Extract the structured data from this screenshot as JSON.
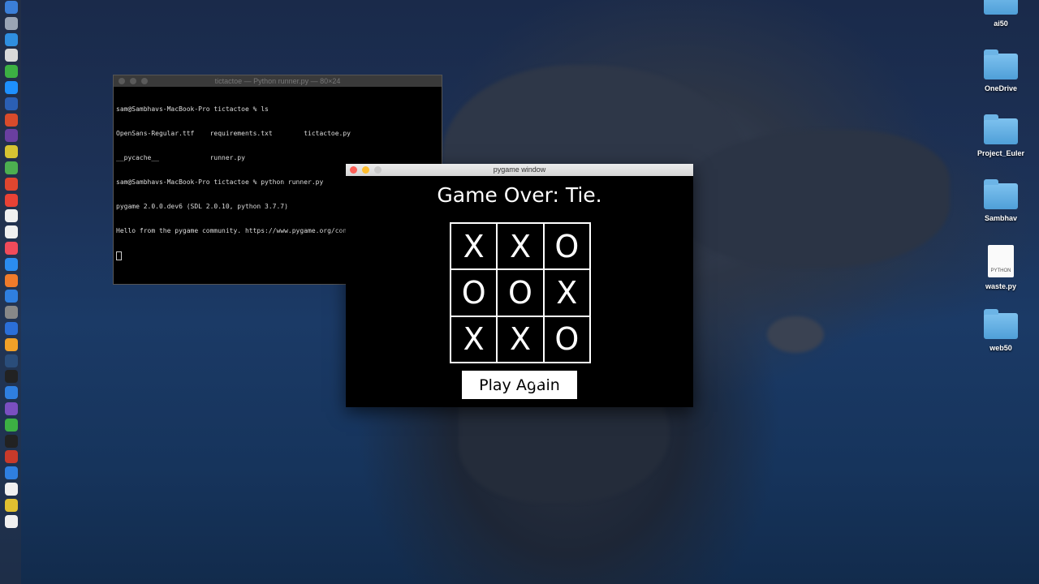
{
  "terminal": {
    "title": "tictactoe — Python runner.py — 80×24",
    "lines": [
      "sam@Sambhavs-MacBook-Pro tictactoe % ls",
      "OpenSans-Regular.ttf    requirements.txt        tictactoe.py",
      "__pycache__             runner.py",
      "sam@Sambhavs-MacBook-Pro tictactoe % python runner.py",
      "pygame 2.0.0.dev6 (SDL 2.0.10, python 3.7.7)",
      "Hello from the pygame community. https://www.pygame.org/contribute.html"
    ]
  },
  "game_window": {
    "title": "pygame window",
    "status": "Game Over: Tie.",
    "board": [
      [
        "X",
        "X",
        "O"
      ],
      [
        "O",
        "O",
        "X"
      ],
      [
        "X",
        "X",
        "O"
      ]
    ],
    "play_again_label": "Play Again"
  },
  "desktop": {
    "items": [
      {
        "label": "ai50",
        "type": "folder"
      },
      {
        "label": "OneDrive",
        "type": "folder"
      },
      {
        "label": "Project_Euler",
        "type": "folder"
      },
      {
        "label": "Sambhav",
        "type": "folder"
      },
      {
        "label": "waste.py",
        "type": "python-file",
        "badge": "PYTHON"
      },
      {
        "label": "web50",
        "type": "folder"
      }
    ]
  },
  "dock": {
    "colors": [
      "#3b7fd8",
      "#9aa5b5",
      "#2f8fe0",
      "#d9d9d9",
      "#3cb043",
      "#1e90ff",
      "#2b5fb4",
      "#d94b2b",
      "#6a3fa0",
      "#d6c332",
      "#4caf50",
      "#e0462f",
      "#e94235",
      "#f0f0f0",
      "#f0f0f0",
      "#f04b5a",
      "#2b8cf0",
      "#f07b2b",
      "#2f7fe0",
      "#888888",
      "#2b6fd8",
      "#f0a028",
      "#2a4d7a",
      "#222222",
      "#2f7fe0",
      "#7a4fc0",
      "#3cb043",
      "#222222",
      "#c83a2a",
      "#2f7fe0",
      "#f0f0f0",
      "#e0c030",
      "#f0f0f0"
    ]
  }
}
